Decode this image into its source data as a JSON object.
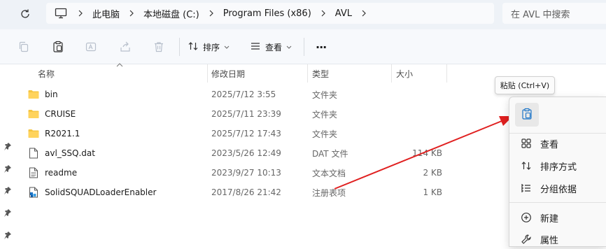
{
  "address": {
    "crumbs": [
      "此电脑",
      "本地磁盘 (C:)",
      "Program Files (x86)",
      "AVL"
    ],
    "search_placeholder": "在 AVL 中搜索"
  },
  "toolbar": {
    "sort_label": "排序",
    "view_label": "查看",
    "more_label": "···"
  },
  "columns": {
    "name": "名称",
    "date": "修改日期",
    "type": "类型",
    "size": "大小"
  },
  "files": [
    {
      "name": "bin",
      "date": "2025/7/12 3:55",
      "type": "文件夹",
      "size": "",
      "icon": "folder-icon"
    },
    {
      "name": "CRUISE",
      "date": "2025/7/11 23:39",
      "type": "文件夹",
      "size": "",
      "icon": "folder-icon"
    },
    {
      "name": "R2021.1",
      "date": "2025/7/12 17:43",
      "type": "文件夹",
      "size": "",
      "icon": "folder-icon"
    },
    {
      "name": "avl_SSQ.dat",
      "date": "2023/5/26 12:49",
      "type": "DAT 文件",
      "size": "114 KB",
      "icon": "file-icon"
    },
    {
      "name": "readme",
      "date": "2023/9/27 10:13",
      "type": "文本文档",
      "size": "2 KB",
      "icon": "text-file-icon"
    },
    {
      "name": "SolidSQUADLoaderEnabler",
      "date": "2017/8/26 21:42",
      "type": "注册表项",
      "size": "1 KB",
      "icon": "registry-file-icon"
    }
  ],
  "tooltip": {
    "text": "粘贴 (Ctrl+V)"
  },
  "context_menu": {
    "items": [
      {
        "label": "查看",
        "icon": "view-grid-icon"
      },
      {
        "label": "排序方式",
        "icon": "sort-icon"
      },
      {
        "label": "分组依据",
        "icon": "group-icon"
      },
      {
        "label": "新建",
        "icon": "new-icon"
      },
      {
        "label": "属性",
        "icon": "properties-icon"
      }
    ]
  },
  "colors": {
    "annotation_arrow": "#e02020",
    "folder": "#f5c542",
    "accent": "#1a73c7"
  }
}
